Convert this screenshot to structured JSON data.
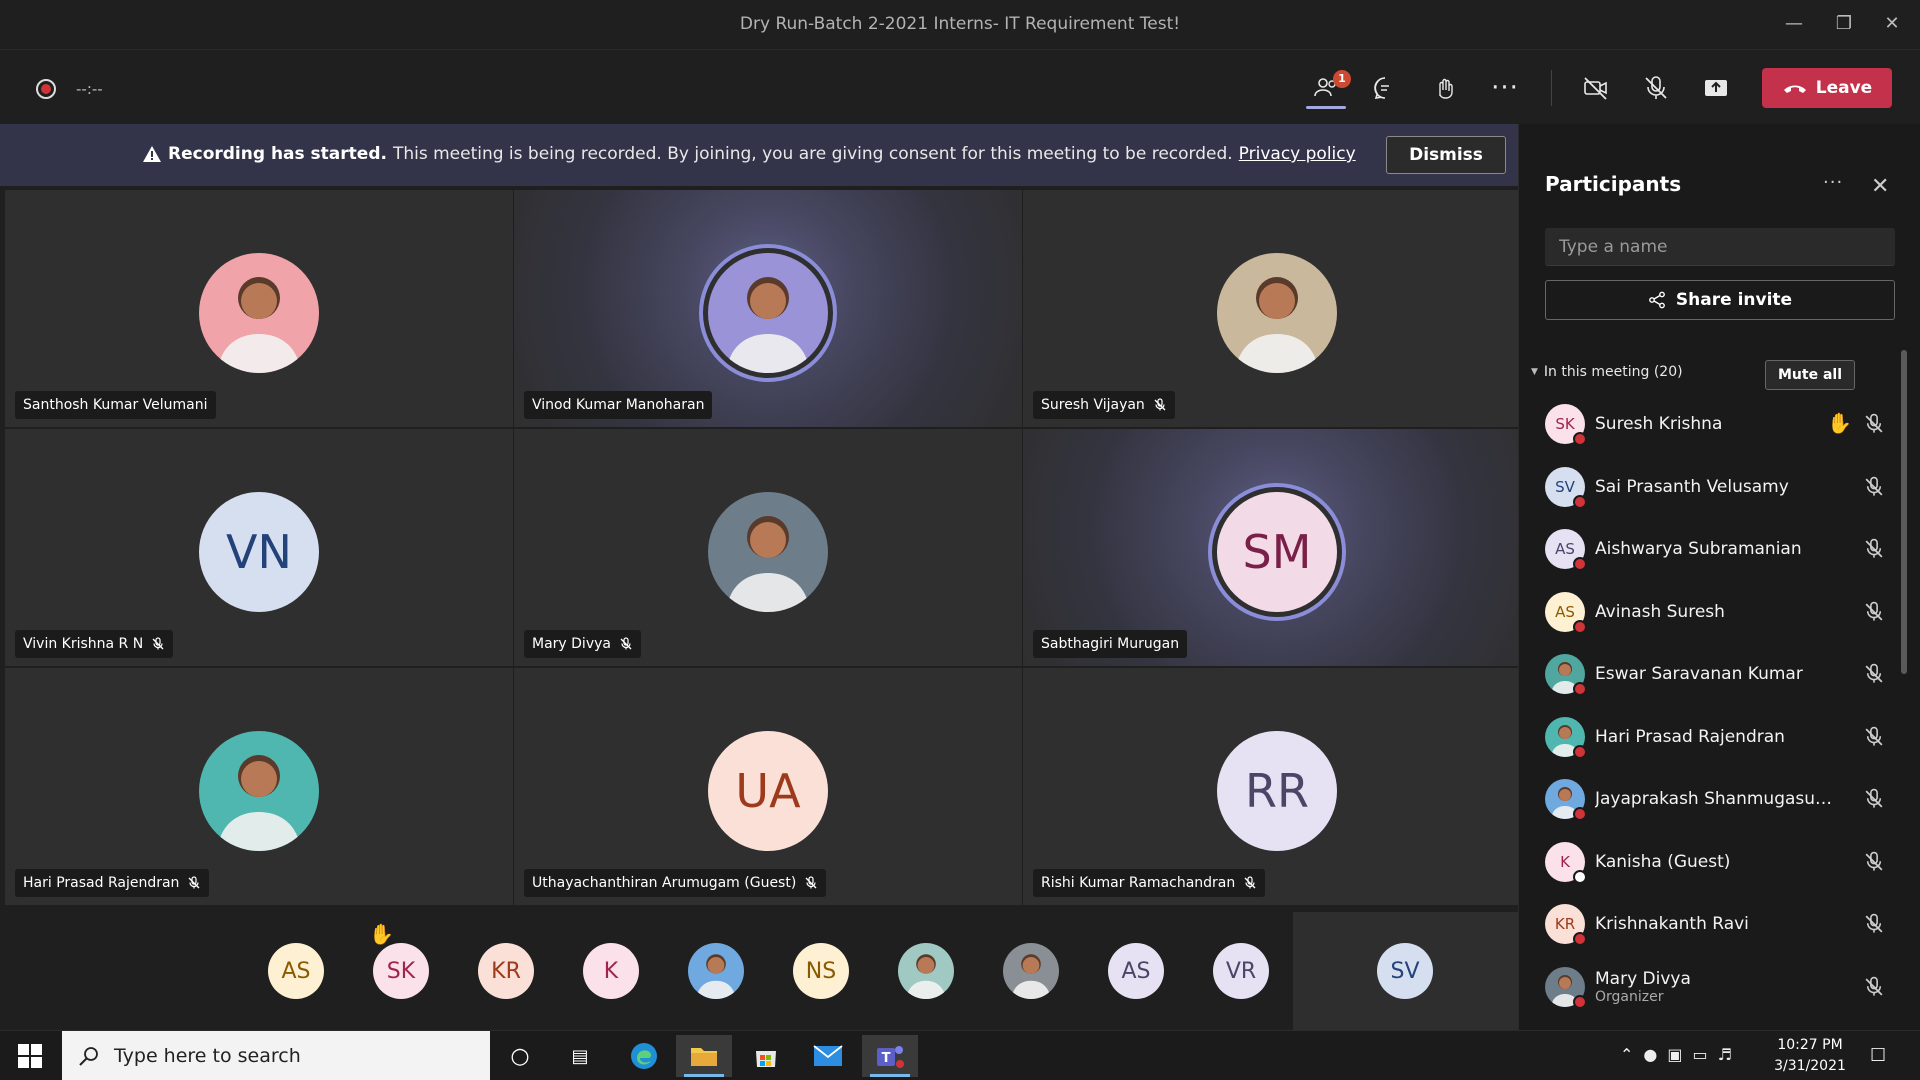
{
  "window": {
    "title": "Dry Run-Batch 2-2021 Interns- IT Requirement Test!",
    "controls": [
      "minimize",
      "restore",
      "close"
    ]
  },
  "toolbar": {
    "recording_time": "--:--",
    "people_badge": "1",
    "leave_label": "Leave",
    "icons": [
      "people-icon",
      "chat-icon",
      "raise-hand-icon",
      "more-icon",
      "camera-off-icon",
      "mic-off-icon",
      "share-screen-icon",
      "phone-hangup-icon"
    ],
    "accent_color": "#a4a7e0",
    "leave_color": "#c4314b"
  },
  "banner": {
    "title": "Recording has started.",
    "message": "This meeting is being recorded. By joining, you are giving consent for this meeting to be recorded.",
    "link": "Privacy policy",
    "dismiss_label": "Dismiss"
  },
  "grid": {
    "tiles": [
      {
        "name": "Santhosh Kumar Velumani",
        "initials": "",
        "muted": false,
        "speaking": false,
        "avatar": "photo",
        "bg": "#f0a3a8"
      },
      {
        "name": "Vinod Kumar Manoharan",
        "initials": "",
        "muted": false,
        "speaking": true,
        "avatar": "photo",
        "bg": "#9a93d8"
      },
      {
        "name": "Suresh Vijayan",
        "initials": "",
        "muted": true,
        "speaking": false,
        "avatar": "photo",
        "bg": "#c9b89c"
      },
      {
        "name": "Vivin Krishna R N",
        "initials": "VN",
        "muted": true,
        "speaking": false,
        "avatar": "initials",
        "bg": "#d5dff0",
        "fg": "#24427a"
      },
      {
        "name": "Mary Divya",
        "initials": "",
        "muted": true,
        "speaking": false,
        "avatar": "photo",
        "bg": "#6d7d8a"
      },
      {
        "name": "Sabthagiri Murugan",
        "initials": "SM",
        "muted": false,
        "speaking": true,
        "avatar": "initials",
        "bg": "#f2dbe7",
        "fg": "#7a1f48"
      },
      {
        "name": "Hari Prasad Rajendran",
        "initials": "",
        "muted": true,
        "speaking": false,
        "avatar": "photo",
        "bg": "#4fb6b0"
      },
      {
        "name": "Uthayachanthiran Arumugam (Guest)",
        "initials": "UA",
        "muted": true,
        "speaking": false,
        "avatar": "initials",
        "bg": "#fbe0d8",
        "fg": "#9c3a1b"
      },
      {
        "name": "Rishi Kumar Ramachandran",
        "initials": "RR",
        "muted": true,
        "speaking": false,
        "avatar": "initials",
        "bg": "#e6e2f3",
        "fg": "#4b4668"
      }
    ]
  },
  "strip": {
    "avatars": [
      {
        "initials": "AS",
        "bg": "#fdf0d3",
        "fg": "#8a5a00",
        "hand": false
      },
      {
        "initials": "SK",
        "bg": "#fbe1ea",
        "fg": "#a0244d",
        "hand": true
      },
      {
        "initials": "KR",
        "bg": "#fbe0d8",
        "fg": "#9c3a1b",
        "hand": false
      },
      {
        "initials": "K",
        "bg": "#fbe1ea",
        "fg": "#a0244d",
        "hand": false
      },
      {
        "initials": "",
        "bg": "#6fa9e0",
        "fg": "#fff",
        "hand": false
      },
      {
        "initials": "NS",
        "bg": "#fdf0d3",
        "fg": "#8a5a00",
        "hand": false
      },
      {
        "initials": "",
        "bg": "#9fc9c2",
        "fg": "#fff",
        "hand": false
      },
      {
        "initials": "",
        "bg": "#8a8f96",
        "fg": "#fff",
        "hand": false
      },
      {
        "initials": "AS",
        "bg": "#e6e2f3",
        "fg": "#4b4668",
        "hand": false
      },
      {
        "initials": "VR",
        "bg": "#e6e2f3",
        "fg": "#4b4668",
        "hand": false
      }
    ],
    "self": {
      "initials": "SV",
      "bg": "#d5dff0",
      "fg": "#24427a"
    }
  },
  "panel": {
    "title": "Participants",
    "search_placeholder": "Type a name",
    "share_label": "Share invite",
    "section_label": "In this meeting (20)",
    "mute_all_label": "Mute all",
    "participants": [
      {
        "name": "Suresh Krishna",
        "initials": "SK",
        "bg": "#fbe1ea",
        "fg": "#a0244d",
        "hand": true,
        "dot": "red",
        "sub": ""
      },
      {
        "name": "Sai Prasanth Velusamy",
        "initials": "SV",
        "bg": "#d5dff0",
        "fg": "#24427a",
        "hand": false,
        "dot": "red",
        "sub": ""
      },
      {
        "name": "Aishwarya Subramanian",
        "initials": "AS",
        "bg": "#e6e2f3",
        "fg": "#4b4668",
        "hand": false,
        "dot": "red",
        "sub": ""
      },
      {
        "name": "Avinash Suresh",
        "initials": "AS",
        "bg": "#fdf0d3",
        "fg": "#8a5a00",
        "hand": false,
        "dot": "red",
        "sub": ""
      },
      {
        "name": "Eswar Saravanan Kumar",
        "initials": "",
        "bg": "#4fa7a0",
        "fg": "#fff",
        "hand": false,
        "dot": "red",
        "sub": ""
      },
      {
        "name": "Hari Prasad Rajendran",
        "initials": "",
        "bg": "#4fb6b0",
        "fg": "#fff",
        "hand": false,
        "dot": "red",
        "sub": ""
      },
      {
        "name": "Jayaprakash Shanmugasunda...",
        "initials": "",
        "bg": "#6fa9e0",
        "fg": "#fff",
        "hand": false,
        "dot": "red",
        "sub": ""
      },
      {
        "name": "Kanisha (Guest)",
        "initials": "K",
        "bg": "#fbe1ea",
        "fg": "#a0244d",
        "hand": false,
        "dot": "white",
        "sub": ""
      },
      {
        "name": "Krishnakanth Ravi",
        "initials": "KR",
        "bg": "#fbe0d8",
        "fg": "#9c3a1b",
        "hand": false,
        "dot": "red",
        "sub": ""
      },
      {
        "name": "Mary Divya",
        "initials": "",
        "bg": "#6d7d8a",
        "fg": "#fff",
        "hand": false,
        "dot": "red",
        "sub": "Organizer"
      }
    ]
  },
  "taskbar": {
    "search_placeholder": "Type here to search",
    "time": "10:27 PM",
    "date": "3/31/2021"
  }
}
